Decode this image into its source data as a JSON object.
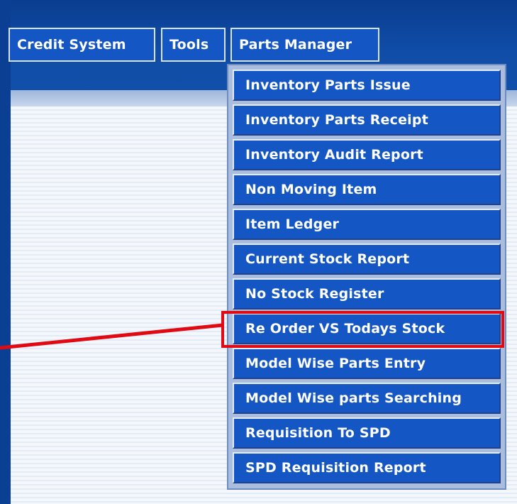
{
  "menubar": {
    "items": [
      "Credit System",
      "Tools",
      "Parts Manager"
    ]
  },
  "dropdown": {
    "items": [
      "Inventory Parts Issue",
      "Inventory Parts Receipt",
      "Inventory Audit Report",
      "Non Moving Item",
      "Item Ledger",
      "Current Stock Report",
      "No Stock Register",
      "Re Order VS Todays Stock",
      "Model Wise Parts Entry",
      "Model Wise parts Searching",
      "Requisition To SPD",
      "SPD Requisition Report"
    ],
    "highlighted": "Re Order VS Todays Stock"
  },
  "colors": {
    "menu_button": "#1456c4",
    "background_blue": "#0a3f93",
    "highlight_red": "#e20a12"
  }
}
